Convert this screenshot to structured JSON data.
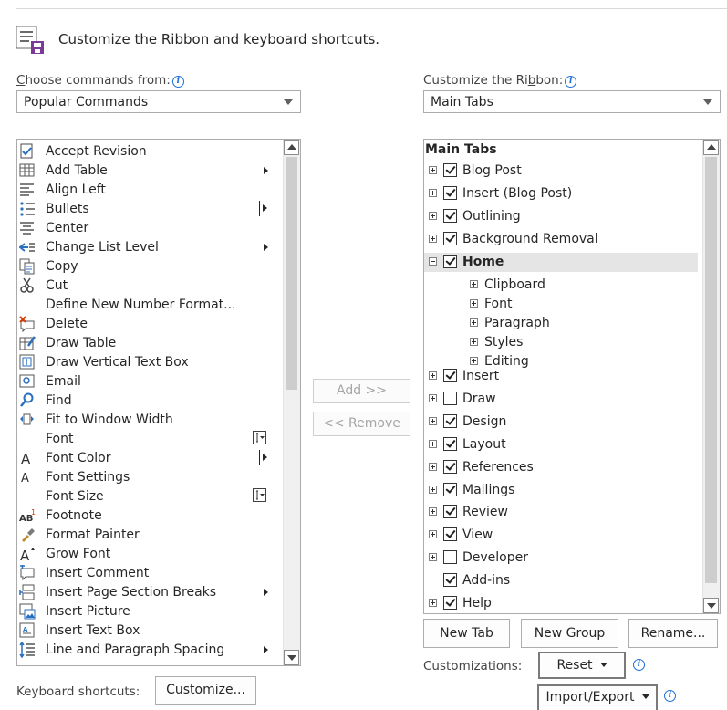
{
  "header": {
    "title": "Customize the Ribbon and keyboard shortcuts."
  },
  "left": {
    "label_prefix": "C",
    "label_rest": "hoose commands from:",
    "combo_value": "Popular Commands",
    "commands": [
      {
        "label": "Accept Revision",
        "icon": "accept-revision-icon",
        "sub": ""
      },
      {
        "label": "Add Table",
        "icon": "table-icon",
        "sub": "arrow"
      },
      {
        "label": "Align Left",
        "icon": "align-left-icon",
        "sub": ""
      },
      {
        "label": "Bullets",
        "icon": "bullets-icon",
        "sub": "split"
      },
      {
        "label": "Center",
        "icon": "align-center-icon",
        "sub": ""
      },
      {
        "label": "Change List Level",
        "icon": "list-level-icon",
        "sub": "arrow"
      },
      {
        "label": "Copy",
        "icon": "copy-icon",
        "sub": ""
      },
      {
        "label": "Cut",
        "icon": "scissors-icon",
        "sub": ""
      },
      {
        "label": "Define New Number Format...",
        "icon": "",
        "sub": ""
      },
      {
        "label": "Delete",
        "icon": "delete-comment-icon",
        "sub": ""
      },
      {
        "label": "Draw Table",
        "icon": "draw-table-icon",
        "sub": ""
      },
      {
        "label": "Draw Vertical Text Box",
        "icon": "vertical-textbox-icon",
        "sub": ""
      },
      {
        "label": "Email",
        "icon": "email-icon",
        "sub": ""
      },
      {
        "label": "Find",
        "icon": "search-icon",
        "sub": ""
      },
      {
        "label": "Fit to Window Width",
        "icon": "fit-width-icon",
        "sub": ""
      },
      {
        "label": "Font",
        "icon": "",
        "sub": "field"
      },
      {
        "label": "Font Color",
        "icon": "font-color-icon",
        "sub": "split"
      },
      {
        "label": "Font Settings",
        "icon": "font-settings-icon",
        "sub": ""
      },
      {
        "label": "Font Size",
        "icon": "",
        "sub": "field"
      },
      {
        "label": "Footnote",
        "icon": "footnote-icon",
        "sub": ""
      },
      {
        "label": "Format Painter",
        "icon": "brush-icon",
        "sub": ""
      },
      {
        "label": "Grow Font",
        "icon": "grow-font-icon",
        "sub": ""
      },
      {
        "label": "Insert Comment",
        "icon": "comment-icon",
        "sub": ""
      },
      {
        "label": "Insert Page  Section Breaks",
        "icon": "page-break-icon",
        "sub": "arrow"
      },
      {
        "label": "Insert Picture",
        "icon": "picture-icon",
        "sub": ""
      },
      {
        "label": "Insert Text Box",
        "icon": "textbox-icon",
        "sub": ""
      },
      {
        "label": "Line and Paragraph Spacing",
        "icon": "line-spacing-icon",
        "sub": "arrow"
      }
    ]
  },
  "right": {
    "label_pre": "Customize the Ri",
    "label_u": "b",
    "label_post": "bon:",
    "combo_value": "Main Tabs",
    "tree_header": "Main Tabs",
    "tree": [
      {
        "label": "Blog Post",
        "level": 0,
        "exp": "plus",
        "check": true
      },
      {
        "label": "Insert (Blog Post)",
        "level": 0,
        "exp": "plus",
        "check": true
      },
      {
        "label": "Outlining",
        "level": 0,
        "exp": "plus",
        "check": true
      },
      {
        "label": "Background Removal",
        "level": 0,
        "exp": "plus",
        "check": true
      },
      {
        "label": "Home",
        "level": 0,
        "exp": "minus",
        "check": true,
        "selected": true
      },
      {
        "label": "Clipboard",
        "level": 1,
        "exp": "plus"
      },
      {
        "label": "Font",
        "level": 1,
        "exp": "plus"
      },
      {
        "label": "Paragraph",
        "level": 1,
        "exp": "plus"
      },
      {
        "label": "Styles",
        "level": 1,
        "exp": "plus"
      },
      {
        "label": "Editing",
        "level": 1,
        "exp": "plus"
      },
      {
        "label": "Insert",
        "level": 0,
        "exp": "plus",
        "check": true
      },
      {
        "label": "Draw",
        "level": 0,
        "exp": "plus",
        "check": false
      },
      {
        "label": "Design",
        "level": 0,
        "exp": "plus",
        "check": true
      },
      {
        "label": "Layout",
        "level": 0,
        "exp": "plus",
        "check": true
      },
      {
        "label": "References",
        "level": 0,
        "exp": "plus",
        "check": true
      },
      {
        "label": "Mailings",
        "level": 0,
        "exp": "plus",
        "check": true
      },
      {
        "label": "Review",
        "level": 0,
        "exp": "plus",
        "check": true
      },
      {
        "label": "View",
        "level": 0,
        "exp": "plus",
        "check": true
      },
      {
        "label": "Developer",
        "level": 0,
        "exp": "plus",
        "check": false
      },
      {
        "label": "Add-ins",
        "level": 0,
        "exp": "none",
        "check": true
      },
      {
        "label": "Help",
        "level": 0,
        "exp": "plus",
        "check": true
      }
    ]
  },
  "mid": {
    "add_label": "Add >>",
    "remove_label": "<< Remove"
  },
  "buttons": {
    "new_tab": "New Tab",
    "new_group": "New Group",
    "rename": "Rename...",
    "customizations_label": "Customizations:",
    "reset": "Reset",
    "import_export": "Import/Export"
  },
  "keyboard": {
    "label": "Keyboard shortcuts:",
    "customize": "Customize..."
  }
}
